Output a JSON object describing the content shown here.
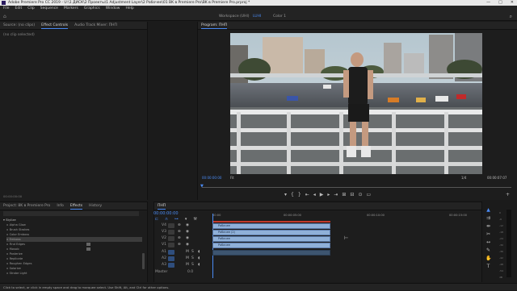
{
  "app": {
    "title": "Adobe Premiere Pro CC 2019 - U:\\1 ДИСК\\2 Проекты\\1 Adjustment Layer\\2 Рабочее\\01 BK в Premiere Pro\\BK в Premiere Pro.prproj *",
    "window_buttons": [
      "—",
      "□",
      "✕"
    ]
  },
  "menu": [
    "File",
    "Edit",
    "Clip",
    "Sequence",
    "Markers",
    "Graphics",
    "Window",
    "Help"
  ],
  "workspaces": [
    "Workspace (UHI)",
    "LUHI",
    "Color 1"
  ],
  "source_panel": {
    "tabs": [
      "Source: (no clips)",
      "Effect Controls",
      "Audio Track Mixer: ПНП"
    ],
    "active_tab": 1,
    "empty_text": "(no clip selected)",
    "timecode": "00:00:00:00"
  },
  "program_panel": {
    "title": "Program: ПНП",
    "timecode_left": "00:00:00:00",
    "fit": "Fit",
    "ratio": "1/4",
    "timecode_right": "00:00:07:07"
  },
  "transport_icons": [
    "marker-icon",
    "in-point-icon",
    "out-point-icon",
    "go-to-in-icon",
    "step-back-icon",
    "play-icon",
    "step-forward-icon",
    "go-to-out-icon",
    "insert-icon",
    "overwrite-icon",
    "export-frame-icon",
    "comparison-icon",
    "add-icon"
  ],
  "project_panel": {
    "tabs": [
      "Project: 8K в Premiere Pro",
      "Info",
      "Effects",
      "History"
    ],
    "active_tab": 2,
    "folder": "Stylize",
    "effects": [
      "Alpha Glow",
      "Brush Strokes",
      "Color Emboss",
      "Emboss",
      "Find Edges",
      "Mosaic",
      "Posterize",
      "Replicate",
      "Roughen Edges",
      "Solarize",
      "Strobe Light"
    ],
    "selected": 3,
    "flagged": [
      4,
      5
    ]
  },
  "timeline": {
    "tab": "ПНП",
    "timecode": "00:00:00:00",
    "ruler": [
      "00:00",
      "00:00:05:00",
      "00:00:10:00",
      "00:00:15:00"
    ],
    "tracks": [
      "V4",
      "V3",
      "V2",
      "V1",
      "A1",
      "A2",
      "A3"
    ],
    "master_label": "Master",
    "master_value": "0.0",
    "clips": [
      "Рабочее",
      "Рабочее (2)",
      "Рабочее",
      "Рабочее"
    ]
  },
  "vu_scale": [
    "0",
    "-6",
    "-12",
    "-18",
    "-24",
    "-30",
    "-36",
    "-42",
    "-48",
    "-54",
    "dB"
  ],
  "status_bar": "Click to select, or click in empty space and drag to marquee select. Use Shift, Alt, and Ctrl for other options.",
  "colors": {
    "accent": "#4a8bf5",
    "panel_bg": "#1d1d1d",
    "clip": "#8fb0d8"
  }
}
